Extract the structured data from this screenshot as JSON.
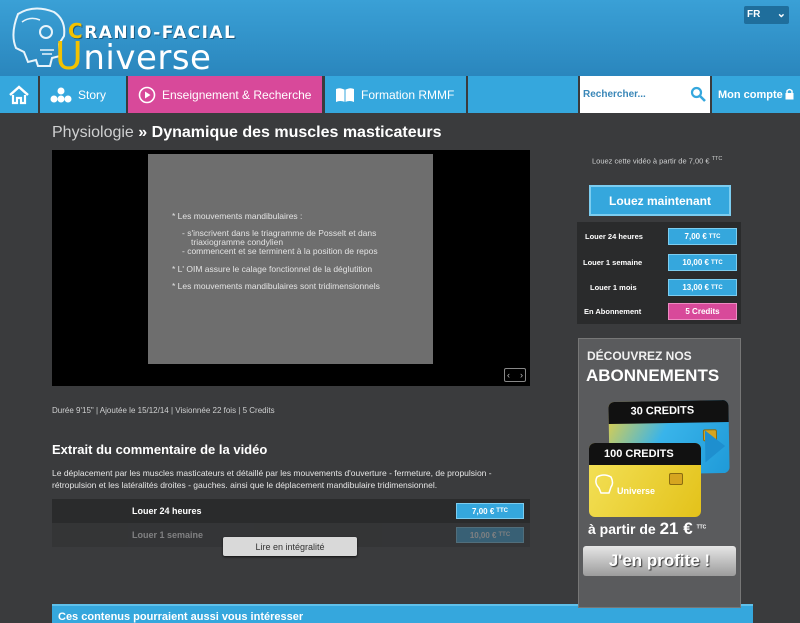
{
  "header": {
    "logo_top_first": "C",
    "logo_top_rest": "RANIO-FACIAL",
    "logo_main_first": "U",
    "logo_main_rest": "niverse",
    "language": "FR"
  },
  "nav": {
    "items": [
      {
        "label": "Story",
        "icon": "molecule-icon"
      },
      {
        "label": "Enseignement & Recherche",
        "icon": "play-circle-icon"
      },
      {
        "label": "Formation RMMF",
        "icon": "book-icon"
      }
    ],
    "search_placeholder": "Rechercher...",
    "account_label": "Mon compte"
  },
  "breadcrumb": {
    "category": "Physiologie",
    "separator": "»",
    "title": "Dynamique des muscles masticateurs"
  },
  "slide": {
    "lines": [
      "* Les mouvements mandibulaires :",
      "- s'inscrivent dans le triagramme de Posselt et dans",
      "triaxiogramme condylien",
      "- commencent  et se terminent à la position de repos",
      "* L' OIM assure le calage fonctionnel de la déglutition",
      "* Les mouvements mandibulaires sont tridimensionnels"
    ]
  },
  "video_meta": "Durée 9'15\" | Ajoutée le 15/12/14 | Visionnée 22 fois | 5 Credits",
  "excerpt": {
    "title": "Extrait du commentaire de la vidéo",
    "body": "Le déplacement par les muscles masticateurs et détaillé par les mouvements d'ouverture - fermeture, de propulsion - rétropulsion et les latéralités droites - gauches. ainsi que le déplacement mandibulaire tridimensionnel.",
    "rent_rows": [
      {
        "label": "Louer 24 heures",
        "price": "7,00 €",
        "tax": "TTC"
      },
      {
        "label": "Louer 1 semaine",
        "price": "10,00 €",
        "tax": "TTC"
      }
    ],
    "read_more": "Lire en intégralité"
  },
  "related_title": "Ces contenus pourraient aussi vous intéresser",
  "sidebar": {
    "rent_from_text": "Louez cette vidéo à partir de 7,00 €",
    "rent_from_tax": "TTC",
    "rent_now": "Louez maintenant",
    "offers": [
      {
        "label": "Louer 24 heures",
        "price": "7,00 €",
        "tax": "TTC"
      },
      {
        "label": "Louer 1 semaine",
        "price": "10,00 €",
        "tax": "TTC"
      },
      {
        "label": "Louer 1 mois",
        "price": "13,00 €",
        "tax": "TTC"
      },
      {
        "label": "En Abonnement",
        "price": "5 Credits",
        "tax": ""
      }
    ],
    "promo": {
      "line1": "DÉCOUVREZ NOS",
      "line2": "ABONNEMENTS",
      "card1": "30 CREDITS",
      "card2": "100 CREDITS",
      "card_brand": "Universe",
      "from_text": "à partir de",
      "from_price": "21 €",
      "from_tax": "TTC",
      "cta": "J'en profite !"
    }
  },
  "colors": {
    "accent_blue": "#35a7dd",
    "accent_pink": "#d8499a",
    "logo_yellow": "#f3c200",
    "background": "#3a3b3d"
  }
}
